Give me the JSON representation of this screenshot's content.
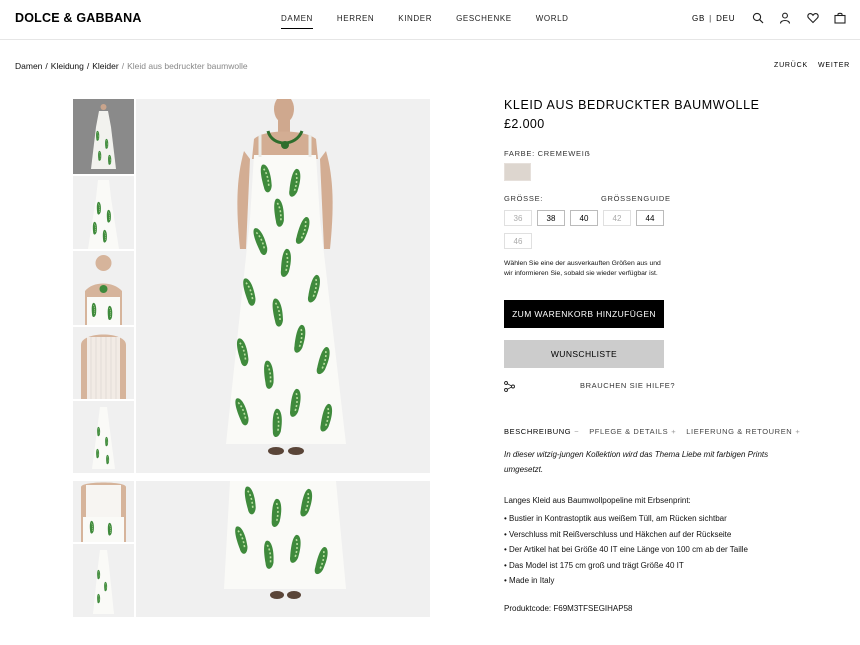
{
  "header": {
    "logo": "DOLCE & GABBANA",
    "nav": [
      "DAMEN",
      "HERREN",
      "KINDER",
      "GESCHENKE",
      "WORLD"
    ],
    "active_nav": "DAMEN",
    "lang_country": "GB",
    "lang_sep": "|",
    "lang_code": "DEU",
    "icons": [
      "search-icon",
      "account-icon",
      "heart-icon",
      "bag-icon"
    ]
  },
  "breadcrumb": {
    "items": [
      "Damen",
      "Kleidung",
      "Kleider"
    ],
    "separator": "/",
    "current": "Kleid aus bedruckter baumwolle"
  },
  "pager": {
    "back": "ZURÜCK",
    "next": "WEITER"
  },
  "product": {
    "title": "KLEID AUS BEDRUCKTER BAUMWOLLE",
    "price": "£2.000",
    "color_label": "FARBE: CREMEWEIẞ",
    "swatch_color": "#ddd6cf",
    "size_label": "GRÖSSE:",
    "size_guide": "GRÖSSENGUIDE",
    "sizes": [
      {
        "label": "36",
        "available": false
      },
      {
        "label": "38",
        "available": true
      },
      {
        "label": "40",
        "available": true
      },
      {
        "label": "42",
        "available": false
      },
      {
        "label": "44",
        "available": true
      },
      {
        "label": "46",
        "available": false
      }
    ],
    "oos_note": "Wählen Sie eine der ausverkauften Größen aus und wir informieren Sie, sobald sie wieder verfügbar ist.",
    "add_to_cart": "ZUM WARENKORB HINZUFÜGEN",
    "wishlist": "WUNSCHLISTE",
    "help": "BRAUCHEN SIE HILFE?"
  },
  "tabs": [
    {
      "label": "BESCHREIBUNG",
      "symbol": "−"
    },
    {
      "label": "PFLEGE & DETAILS",
      "symbol": "+"
    },
    {
      "label": "LIEFERUNG & RETOUREN",
      "symbol": "+"
    }
  ],
  "description": {
    "intro": "In dieser witzig-jungen Kollektion wird das Thema Liebe mit farbigen Prints umgesetzt.",
    "heading": "Langes Kleid aus Baumwollpopeline mit Erbsenprint:",
    "bullets": [
      "Bustier in Kontrastoptik aus weißem Tüll, am Rücken sichtbar",
      "Verschluss mit Reißverschluss und Häkchen auf der Rückseite",
      "Der Artikel hat bei Größe 40 IT eine Länge von 100 cm ab der Taille",
      "Das Model ist 175 cm groß und trägt Größe 40 IT",
      "Made in Italy"
    ],
    "product_code": "Produktcode: F69M3TFSEGIHAP58"
  },
  "colors": {
    "print_green": "#3f8a3c",
    "print_light_green": "#8cc47e",
    "dress_white": "#f7f7f4",
    "image_bg": "#f0f0f0"
  }
}
